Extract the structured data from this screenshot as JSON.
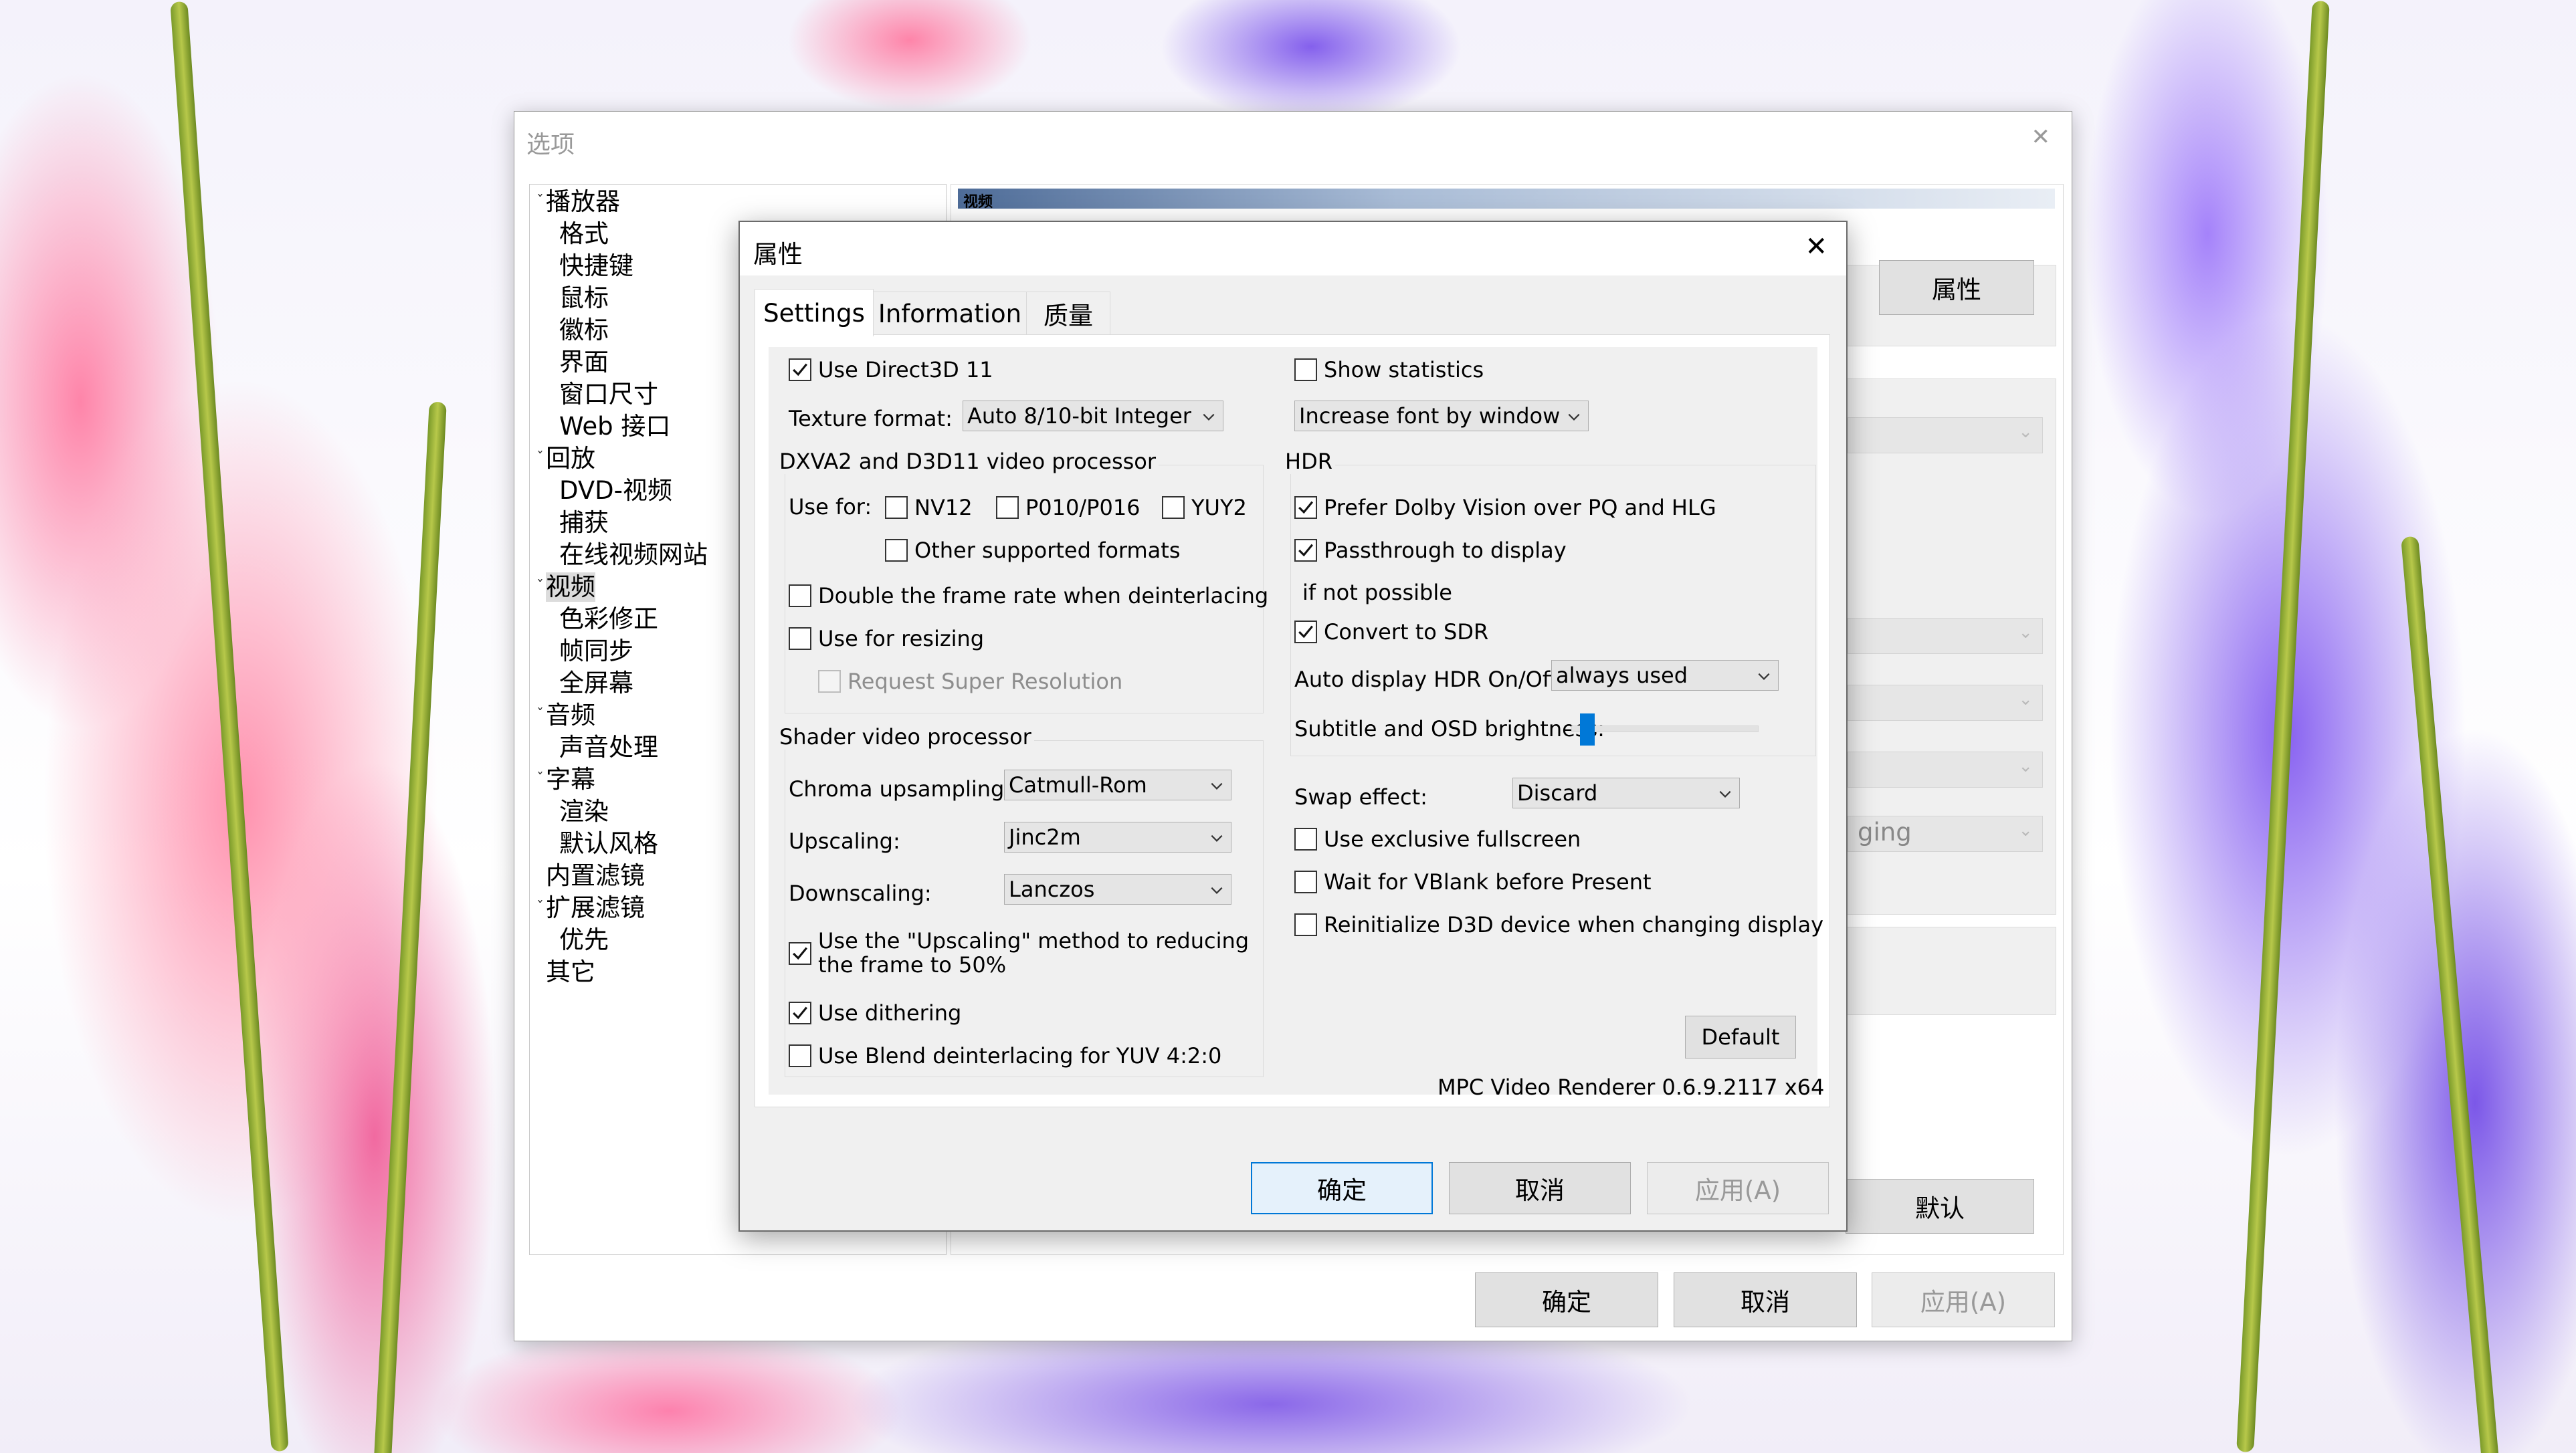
{
  "options": {
    "title": "选项",
    "section_title": "视频",
    "tree": [
      {
        "label": "播放器",
        "level": 0,
        "expanded": true
      },
      {
        "label": "格式",
        "level": 1
      },
      {
        "label": "快捷键",
        "level": 1
      },
      {
        "label": "鼠标",
        "level": 1
      },
      {
        "label": "徽标",
        "level": 1
      },
      {
        "label": "界面",
        "level": 1
      },
      {
        "label": "窗口尺寸",
        "level": 1
      },
      {
        "label": "Web 接口",
        "level": 1
      },
      {
        "label": "回放",
        "level": 0,
        "expanded": true
      },
      {
        "label": "DVD-视频",
        "level": 1
      },
      {
        "label": "捕获",
        "level": 1
      },
      {
        "label": "在线视频网站",
        "level": 1
      },
      {
        "label": "视频",
        "level": 0,
        "expanded": true,
        "selected": true
      },
      {
        "label": "色彩修正",
        "level": 1
      },
      {
        "label": "帧同步",
        "level": 1
      },
      {
        "label": "全屏幕",
        "level": 1
      },
      {
        "label": "音频",
        "level": 0,
        "expanded": true
      },
      {
        "label": "声音处理",
        "level": 1
      },
      {
        "label": "字幕",
        "level": 0,
        "expanded": true
      },
      {
        "label": "渲染",
        "level": 1
      },
      {
        "label": "默认风格",
        "level": 1
      },
      {
        "label": "内置滤镜",
        "level": 0
      },
      {
        "label": "扩展滤镜",
        "level": 0,
        "expanded": true
      },
      {
        "label": "优先",
        "level": 1
      },
      {
        "label": "其它",
        "level": 0
      }
    ],
    "properties_button": "属性",
    "partial_combo_text": "ging",
    "default_button": "默认",
    "ok_button": "确定",
    "cancel_button": "取消",
    "apply_button": "应用(A)"
  },
  "dialog": {
    "title": "属性",
    "tabs": [
      "Settings",
      "Information",
      "质量"
    ],
    "active_tab": 0,
    "settings": {
      "use_d3d11": {
        "label": "Use Direct3D 11",
        "checked": true
      },
      "texture_format_label": "Texture format:",
      "texture_format_value": "Auto 8/10-bit Integer",
      "dxva_group_title": "DXVA2 and D3D11 video processor",
      "use_for_label": "Use for:",
      "nv12": {
        "label": "NV12",
        "checked": false
      },
      "p010": {
        "label": "P010/P016",
        "checked": false
      },
      "yuy2": {
        "label": "YUY2",
        "checked": false
      },
      "other_formats": {
        "label": "Other supported formats",
        "checked": false
      },
      "double_frame_rate": {
        "label": "Double the frame rate when deinterlacing",
        "checked": false
      },
      "use_for_resizing": {
        "label": "Use for resizing",
        "checked": false
      },
      "super_resolution": {
        "label": "Request Super Resolution",
        "checked": false,
        "disabled": true
      },
      "shader_group_title": "Shader video processor",
      "chroma_label": "Chroma upsampling:",
      "chroma_value": "Catmull-Rom",
      "upscaling_label": "Upscaling:",
      "upscaling_value": "Jinc2m",
      "downscaling_label": "Downscaling:",
      "downscaling_value": "Lanczos",
      "use_upscaling_line1": "Use the \"Upscaling\" method to reducing",
      "use_upscaling_line2": "the frame to 50%",
      "use_upscaling_checked": true,
      "use_dithering": {
        "label": "Use dithering",
        "checked": true
      },
      "blend_deinterlacing": {
        "label": "Use Blend deinterlacing for YUV 4:2:0",
        "checked": false
      },
      "show_statistics": {
        "label": "Show statistics",
        "checked": false
      },
      "stats_font_value": "Increase font by window",
      "hdr_group_title": "HDR",
      "prefer_dolby": {
        "label": "Prefer Dolby Vision over PQ and HLG",
        "checked": true
      },
      "passthrough": {
        "label": "Passthrough to display",
        "checked": true
      },
      "if_not_possible": "if not possible",
      "convert_sdr": {
        "label": "Convert to SDR",
        "checked": true
      },
      "auto_hdr_label": "Auto display HDR On/Off:",
      "auto_hdr_value": "always used",
      "subtitle_brightness_label": "Subtitle and OSD brightness:",
      "subtitle_brightness_level": 0.05,
      "swap_effect_label": "Swap effect:",
      "swap_effect_value": "Discard",
      "exclusive_fullscreen": {
        "label": "Use exclusive fullscreen",
        "checked": false
      },
      "wait_vblank": {
        "label": "Wait for VBlank before Present",
        "checked": false
      },
      "reinit_d3d": {
        "label": "Reinitialize D3D device when changing display",
        "checked": false
      },
      "default_button": "Default",
      "version_text": "MPC Video Renderer 0.6.9.2117 x64"
    },
    "ok_button": "确定",
    "cancel_button": "取消",
    "apply_button": "应用(A)"
  },
  "colors": {
    "accent": "#0078d7",
    "dialog_bg": "#f0f0f0"
  },
  "icons": {
    "close": "close-icon",
    "check": "check-icon",
    "chevron": "chevron-down-icon",
    "expander": "tree-expander-icon"
  }
}
